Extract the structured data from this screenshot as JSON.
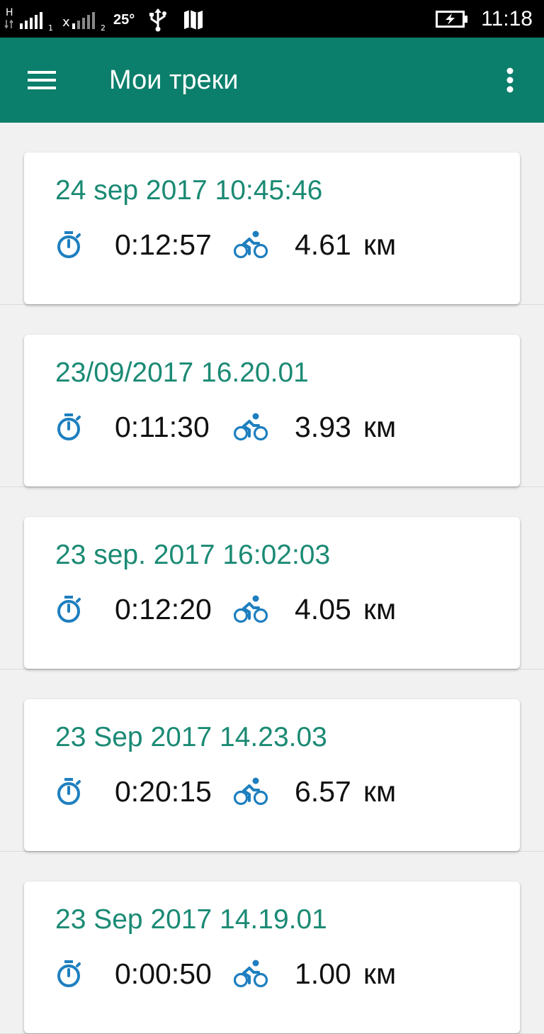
{
  "status_bar": {
    "network_1": "H",
    "sim_1": "1",
    "network_2": "x",
    "sim_2": "2",
    "temperature": "25°",
    "time": "11:18"
  },
  "app_bar": {
    "title": "Мои треки"
  },
  "tracks": [
    {
      "date": "24 sep 2017 10:45:46",
      "duration": "0:12:57",
      "distance": "4.61",
      "unit": "км"
    },
    {
      "date": "23/09/2017 16.20.01",
      "duration": "0:11:30",
      "distance": "3.93",
      "unit": "км"
    },
    {
      "date": "23 sep. 2017 16:02:03",
      "duration": "0:12:20",
      "distance": "4.05",
      "unit": "км"
    },
    {
      "date": "23 Sep 2017 14.23.03",
      "duration": "0:20:15",
      "distance": "6.57",
      "unit": "км"
    },
    {
      "date": "23 Sep 2017 14.19.01",
      "duration": "0:00:50",
      "distance": "1.00",
      "unit": "км"
    }
  ],
  "colors": {
    "primary": "#0b7f6b",
    "accent_text": "#1b8a74",
    "icon": "#1e7fbf",
    "background": "#f2f1f2"
  },
  "icons": {
    "menu": "hamburger-menu-icon",
    "more": "more-vert-icon",
    "duration": "stopwatch-icon",
    "activity": "bicycle-icon"
  }
}
